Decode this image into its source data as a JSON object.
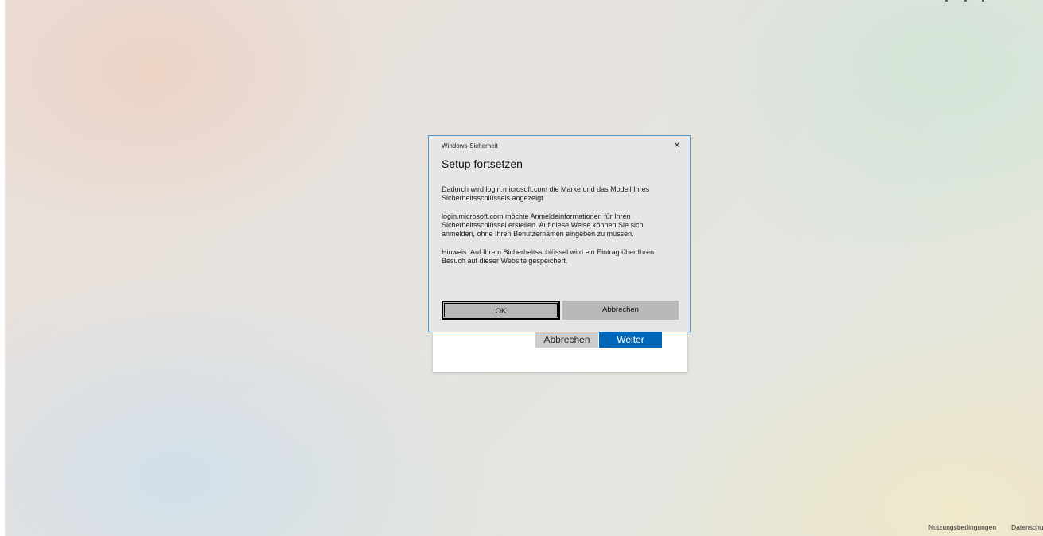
{
  "dialog": {
    "caption": "Windows-Sicherheit",
    "close_glyph": "✕",
    "title": "Setup fortsetzen",
    "paragraphs": [
      "Dadurch wird login.microsoft.com die Marke und das Modell Ihres Sicherheitsschlüssels angezeigt",
      "login.microsoft.com möchte Anmeldeinformationen für Ihren Sicherheitsschlüssel erstellen. Auf diese Weise können Sie sich anmelden, ohne Ihren Benutzernamen eingeben zu müssen.",
      "Hinweis: Auf Ihrem Sicherheitsschlüssel wird ein Eintrag über Ihren Besuch auf dieser Website gespeichert."
    ],
    "ok_label": "OK",
    "cancel_label": "Abbrechen",
    "accent_border": "#4a9ad8"
  },
  "login_card": {
    "back_label": "Abbrechen",
    "next_label": "Weiter",
    "next_color": "#0067b8"
  },
  "footer": {
    "terms": "Nutzungsbedingungen",
    "privacy": "Datenschu"
  }
}
